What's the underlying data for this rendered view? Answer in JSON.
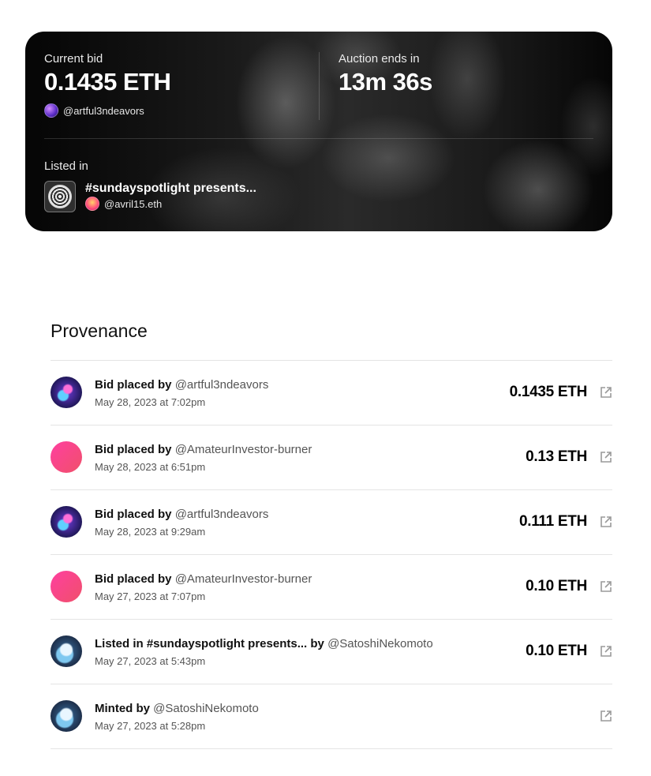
{
  "auction": {
    "current_bid_label": "Current bid",
    "current_bid_value": "0.1435 ETH",
    "bidder_handle": "@artful3ndeavors",
    "ends_label": "Auction ends in",
    "ends_value": "13m 36s",
    "listed_in_label": "Listed in",
    "collection_name": "#sundayspotlight presents...",
    "collection_owner": "@avril15.eth"
  },
  "provenance": {
    "title": "Provenance",
    "rows": [
      {
        "action": "Bid placed by",
        "handle": "@artful3ndeavors",
        "date": "May 28, 2023 at 7:02pm",
        "amount": "0.1435 ETH",
        "avatar": "art-avatar"
      },
      {
        "action": "Bid placed by",
        "handle": "@AmateurInvestor-burner",
        "date": "May 28, 2023 at 6:51pm",
        "amount": "0.13 ETH",
        "avatar": "pink-gradient-avatar"
      },
      {
        "action": "Bid placed by",
        "handle": "@artful3ndeavors",
        "date": "May 28, 2023 at 9:29am",
        "amount": "0.111 ETH",
        "avatar": "art-avatar"
      },
      {
        "action": "Bid placed by",
        "handle": "@AmateurInvestor-burner",
        "date": "May 27, 2023 at 7:07pm",
        "amount": "0.10 ETH",
        "avatar": "pink-gradient-avatar"
      },
      {
        "action": "Listed in #sundayspotlight presents... by",
        "handle": "@SatoshiNekomoto",
        "date": "May 27, 2023 at 5:43pm",
        "amount": "0.10 ETH",
        "avatar": "satoshi-avatar"
      },
      {
        "action": "Minted by",
        "handle": "@SatoshiNekomoto",
        "date": "May 27, 2023 at 5:28pm",
        "amount": "",
        "avatar": "satoshi-avatar"
      }
    ]
  },
  "icons": {
    "external_link": "external-link-icon"
  }
}
